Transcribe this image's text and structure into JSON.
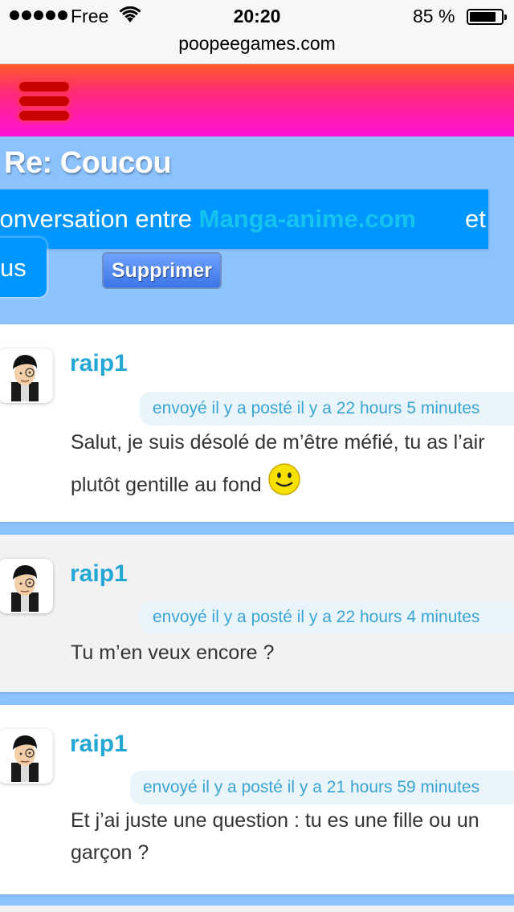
{
  "status_bar": {
    "carrier": "Free",
    "time": "20:20",
    "battery_percent": "85 %",
    "battery_level": 0.85
  },
  "url_bar": {
    "domain": "poopeegames.com"
  },
  "header": {
    "menu_icon": "hamburger-icon",
    "colors": {
      "top": "#ff5a2a",
      "bottom": "#ff10d8"
    }
  },
  "conversation": {
    "title": "Re: Coucou",
    "intro_text": "conversation entre ",
    "site_name": "Manga-anime.com",
    "intro_tail": "et",
    "participant_fragment": "us",
    "delete_label": "Supprimer"
  },
  "messages": [
    {
      "author": "raip1",
      "meta": "envoyé il y a posté il y a 22 hours  5 minutes",
      "body": "Salut, je suis désolé de m’être méfié, tu as l’air plutôt gentille au fond",
      "has_smiley": true
    },
    {
      "author": "raip1",
      "meta": "envoyé il y a posté il y a 22 hours  4 minutes",
      "body": "Tu m’en veux encore ?",
      "has_smiley": false
    },
    {
      "author": "raip1",
      "meta": "envoyé il y a posté il y a 21 hours  59 minutes",
      "body": "Et j’ai juste une question : tu es une fille ou un garçon ?",
      "has_smiley": false
    }
  ],
  "colors": {
    "page_bg": "#8cc3ff",
    "accent_blue": "#0096ff",
    "author_color": "#24a7d4"
  }
}
